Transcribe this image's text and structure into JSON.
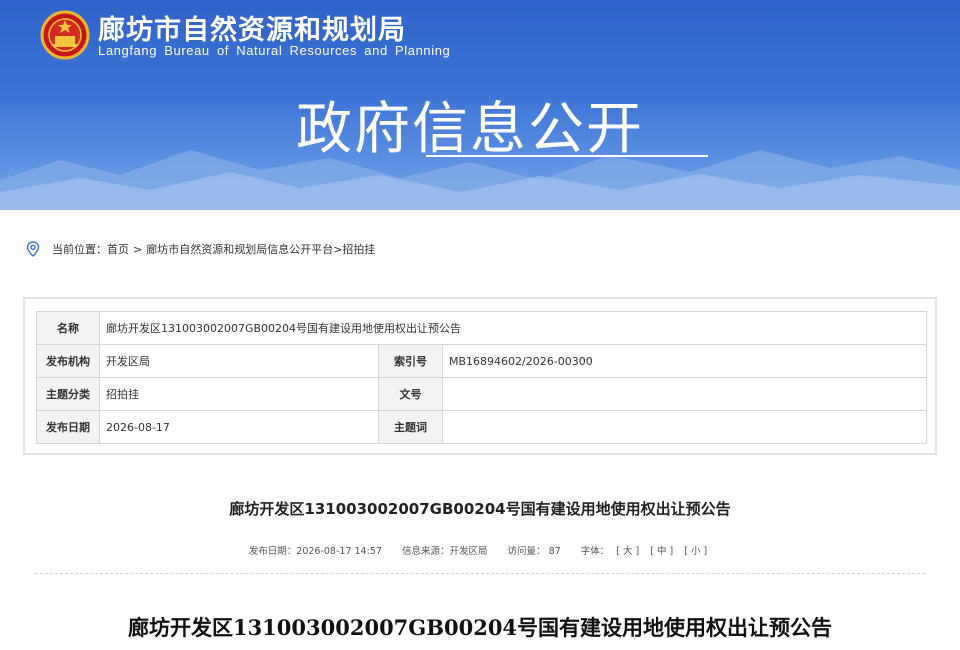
{
  "header": {
    "title": "廊坊市自然资源和规划局",
    "subtitle": "Langfang Bureau of Natural Resources and Planning",
    "banner_heading": "政府信息公开",
    "emblem_icon": "national-emblem-icon",
    "banner_color": "#3a6fd3"
  },
  "breadcrumb": {
    "prefix": "当前位置：",
    "home": "首页",
    "arrow": ">",
    "platform": "廊坊市自然资源和规划局信息公开平台",
    "current": ">招拍挂"
  },
  "meta": {
    "name_label": "名称",
    "name_value": "廊坊开发区131003002007GB00204号国有建设用地使用权出让预公告",
    "org_label": "发布机构",
    "org_value": "开发区局",
    "index_label": "索引号",
    "index_value": "MB16894602/2026-00300",
    "topic_label": "主题分类",
    "topic_value": "招拍挂",
    "docno_label": "文号",
    "docno_value": "",
    "date_label": "发布日期",
    "date_value": "2026-08-17",
    "keyword_label": "主题词",
    "keyword_value": ""
  },
  "article": {
    "title": "廊坊开发区131003002007GB00204号国有建设用地使用权出让预公告",
    "publish_label": "发布日期：2026-08-17 14:57",
    "source_label": "信息来源：开发区局",
    "views_label": "访问量：",
    "views_value": "87",
    "font_label": "字体：",
    "font_large": "[ 大 ]",
    "font_medium": "[ 中 ]",
    "font_small": "[ 小 ]",
    "doc_heading": "廊坊开发区131003002007GB00204号国有建设用地使用权出让预公告"
  }
}
